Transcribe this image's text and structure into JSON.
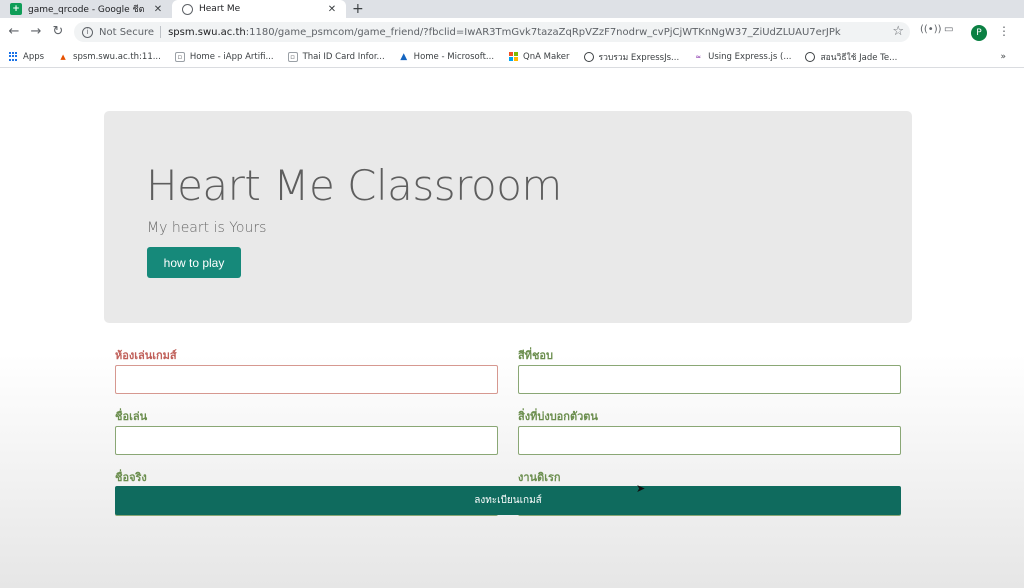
{
  "browser": {
    "tabs": [
      {
        "title": "game_qrcode - Google ชีต",
        "icon": "sheets-icon",
        "active": false
      },
      {
        "title": "Heart Me",
        "icon": "globe-icon",
        "active": true
      }
    ],
    "new_tab": "+",
    "address": {
      "security": "Not Secure",
      "host": "spsm.swu.ac.th",
      "rest": ":1180/game_psmcom/game_friend/?fbclid=IwAR3TmGvk7tazaZqRpVZzF7nodrw_cvPjCjWTKnNgW37_ZiUdZLUAU7erJPk"
    },
    "profile_initial": "P",
    "bookmarks": [
      {
        "label": "Apps",
        "icon": "apps-grid-icon"
      },
      {
        "label": "spsm.swu.ac.th:11...",
        "icon": "university-icon"
      },
      {
        "label": "Home - iApp Artifi...",
        "icon": "iapp-icon"
      },
      {
        "label": "Thai ID Card Infor...",
        "icon": "iapp-icon"
      },
      {
        "label": "Home - Microsoft...",
        "icon": "azure-icon"
      },
      {
        "label": "QnA Maker",
        "icon": "microsoft-icon"
      },
      {
        "label": "รวบรวม ExpressJs...",
        "icon": "globe-icon"
      },
      {
        "label": "Using Express.js (...",
        "icon": "wave-icon"
      },
      {
        "label": "สอนวิธีใช้ Jade Te...",
        "icon": "globe-icon"
      }
    ],
    "more": "»"
  },
  "jumbotron": {
    "title": "Heart Me Classroom",
    "subtitle": "My heart is Yours",
    "button": "how to play"
  },
  "form": {
    "fields": [
      {
        "label": "ห้องเล่นเกมส์",
        "error": true
      },
      {
        "label": "สีที่ชอบ",
        "error": false
      },
      {
        "label": "ชื่อเล่น",
        "error": false
      },
      {
        "label": "สิ่งที่บ่งบอกตัวตน",
        "error": false
      },
      {
        "label": "ชื่อจริง",
        "error": false
      },
      {
        "label": "งานดิเรก",
        "error": false
      }
    ],
    "submit": "ลงทะเบียนเกมส์"
  },
  "colors": {
    "accent": "#16897a",
    "submit": "#0f6b5e",
    "label": "#6b8e4e",
    "error": "#c0605a"
  }
}
